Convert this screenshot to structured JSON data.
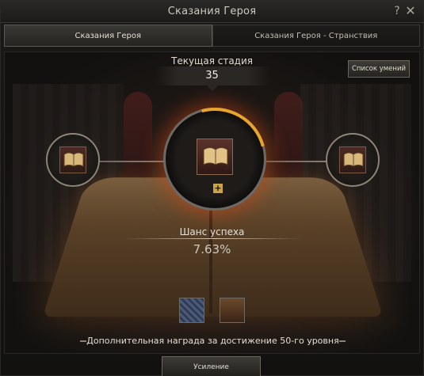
{
  "window": {
    "title": "Сказания Героя",
    "help_label": "?",
    "close_label": "✕"
  },
  "tabs": [
    {
      "label": "Сказания Героя",
      "active": true
    },
    {
      "label": "Сказания Героя - Странствия",
      "active": false
    }
  ],
  "stage": {
    "label": "Текущая стадия",
    "value": "35"
  },
  "skills_button": {
    "label": "Список умений"
  },
  "success": {
    "label": "Шанс успеха",
    "value": "7.63%"
  },
  "reward": {
    "text": "Дополнительная награда за достижение 50-го уровня"
  },
  "enhance_button": {
    "label": "Усиление"
  },
  "icons": {
    "center_slot": "book-icon",
    "left_slot": "book-icon",
    "right_slot": "book-icon",
    "add": "plus-icon"
  },
  "colors": {
    "accent_gold": "#e7a52b",
    "glow_red": "#dc4614"
  }
}
